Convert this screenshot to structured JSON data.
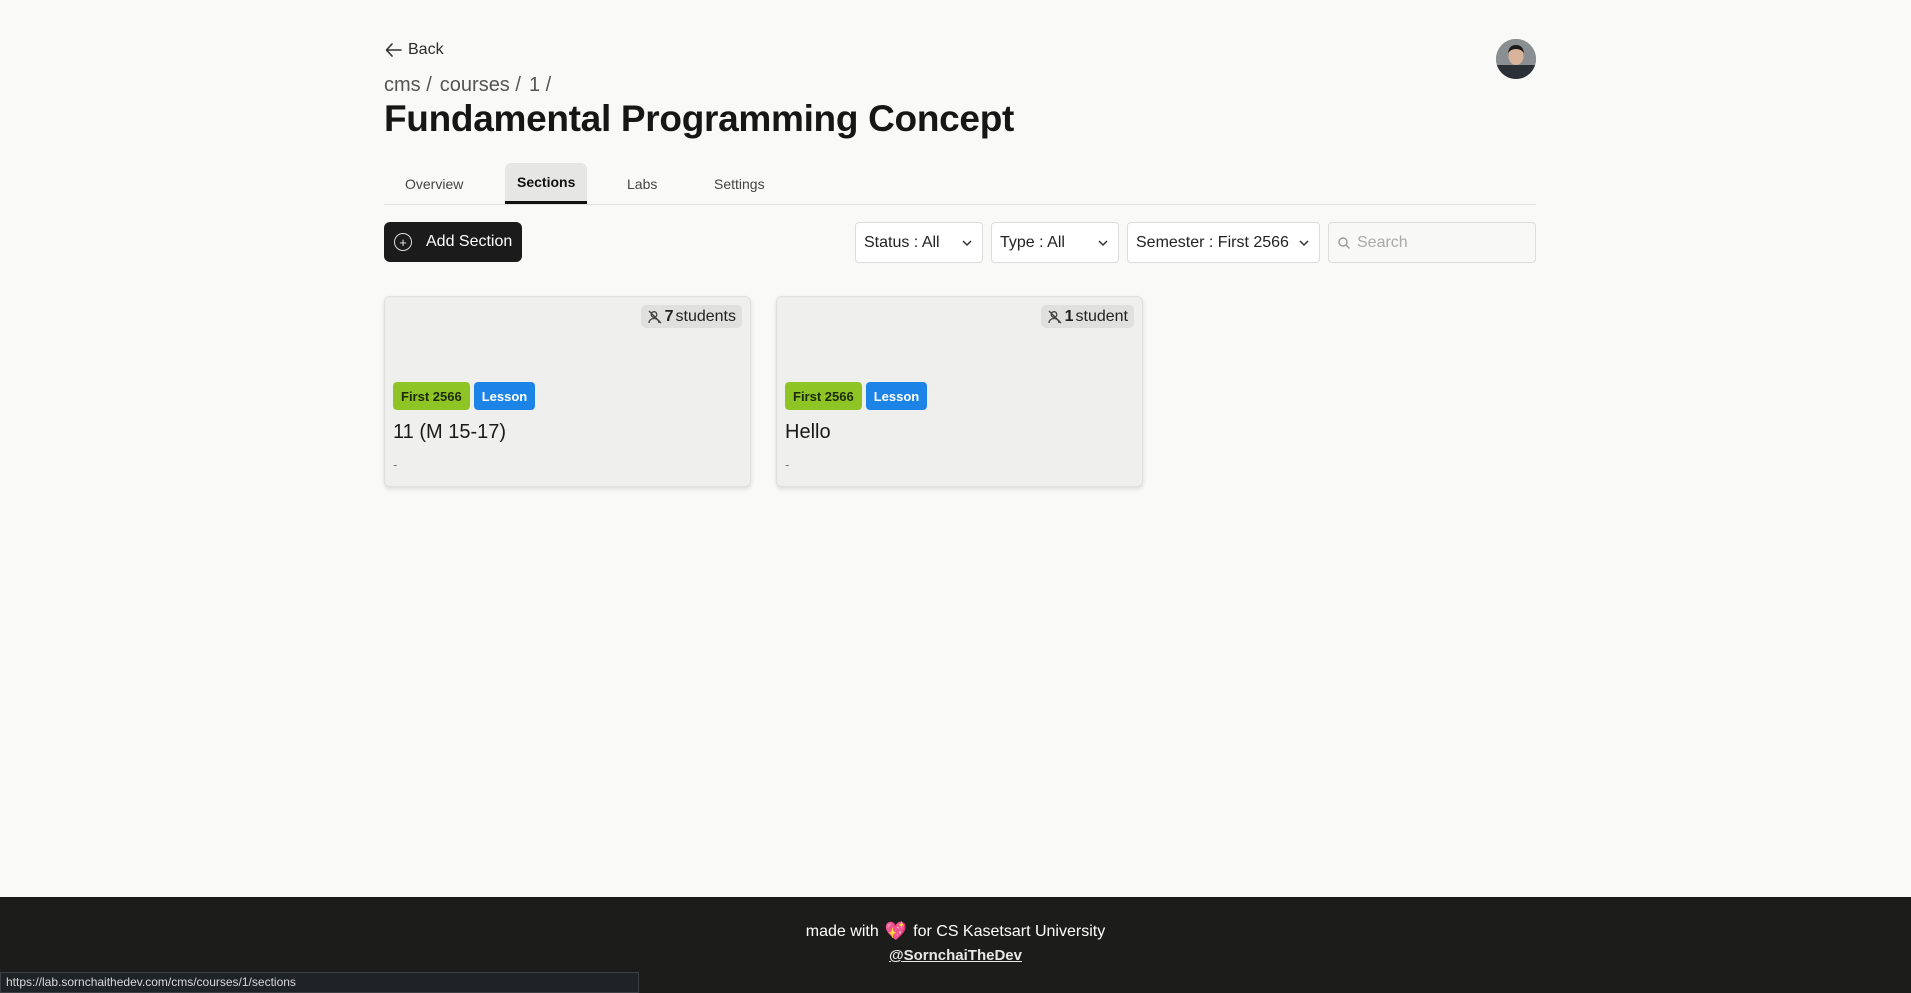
{
  "header": {
    "back_label": "Back",
    "breadcrumb": [
      "cms /",
      "courses /",
      "1 /"
    ],
    "title": "Fundamental Programming Concept"
  },
  "tabs": [
    {
      "label": "Overview",
      "active": false
    },
    {
      "label": "Sections",
      "active": true
    },
    {
      "label": "Labs",
      "active": false
    },
    {
      "label": "Settings",
      "active": false
    }
  ],
  "toolbar": {
    "add_label": "Add Section",
    "status_filter": "Status : All",
    "type_filter": "Type : All",
    "semester_filter": "Semester : First 2566",
    "search_placeholder": "Search"
  },
  "sections": [
    {
      "count": "7",
      "count_unit": "students",
      "semester": "First 2566",
      "type": "Lesson",
      "name": "11 (M 15-17)",
      "description": "-"
    },
    {
      "count": "1",
      "count_unit": "student",
      "semester": "First 2566",
      "type": "Lesson",
      "name": "Hello",
      "description": "-"
    }
  ],
  "footer": {
    "made_with": "made with",
    "for_text": "for CS Kasetsart University",
    "handle": "@SornchaiTheDev"
  },
  "status_bar_url": "https://lab.sornchaithedev.com/cms/courses/1/sections",
  "colors": {
    "semester_badge": "#8ec424",
    "type_badge": "#1c84e6",
    "footer_bg": "#1c1c1a",
    "primary_button": "#1b1b1b"
  }
}
